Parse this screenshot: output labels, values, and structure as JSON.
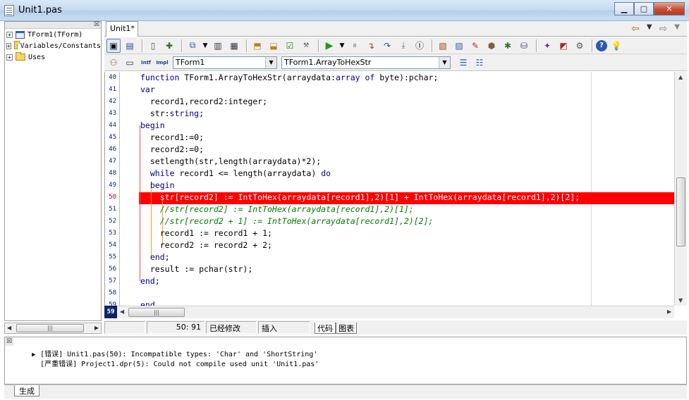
{
  "window": {
    "title": "Unit1.pas"
  },
  "tree": {
    "items": [
      {
        "label": "TForm1(TForm)",
        "icon": "form-icon"
      },
      {
        "label": "Variables/Constants",
        "icon": "folder-icon"
      },
      {
        "label": "Uses",
        "icon": "folder-icon"
      }
    ]
  },
  "editor": {
    "tab_label": "Unit1*",
    "class_combo": "TForm1",
    "method_combo": "TForm1.ArrayToHexStr",
    "error_line": 50,
    "lines": [
      {
        "n": "40",
        "segments": [
          {
            "t": "function ",
            "c": "kw"
          },
          {
            "t": "TForm1.ArrayToHexStr(arraydata:",
            "c": ""
          },
          {
            "t": "array of ",
            "c": "kw"
          },
          {
            "t": "byte):pchar;",
            "c": ""
          }
        ]
      },
      {
        "n": "41",
        "segments": [
          {
            "t": "var",
            "c": "kw"
          }
        ]
      },
      {
        "n": "42",
        "segments": [
          {
            "t": "  record1,record2:integer;",
            "c": ""
          }
        ]
      },
      {
        "n": "43",
        "segments": [
          {
            "t": "  str:",
            "c": ""
          },
          {
            "t": "string",
            "c": "kw"
          },
          {
            "t": ";",
            "c": ""
          }
        ]
      },
      {
        "n": "44",
        "segments": [
          {
            "t": "begin",
            "c": "kw"
          }
        ]
      },
      {
        "n": "45",
        "segments": [
          {
            "t": "  record1:=0;",
            "c": ""
          }
        ]
      },
      {
        "n": "46",
        "segments": [
          {
            "t": "  record2:=0;",
            "c": ""
          }
        ]
      },
      {
        "n": "47",
        "segments": [
          {
            "t": "  setlength(str,length(arraydata)*2);",
            "c": ""
          }
        ]
      },
      {
        "n": "48",
        "segments": [
          {
            "t": "  ",
            "c": ""
          },
          {
            "t": "while ",
            "c": "kw"
          },
          {
            "t": "record1 <= length(arraydata) ",
            "c": ""
          },
          {
            "t": "do",
            "c": "kw"
          }
        ]
      },
      {
        "n": "49",
        "segments": [
          {
            "t": "  ",
            "c": ""
          },
          {
            "t": "begin",
            "c": "kw"
          }
        ]
      },
      {
        "n": "50",
        "segments": [
          {
            "t": "    str[record2] := IntToHex(arraydata[record1],2)[1] + IntToHex(arraydata[record1],2)[2];",
            "c": "err"
          }
        ]
      },
      {
        "n": "51",
        "segments": [
          {
            "t": "    //str[record2] := IntToHex(arraydata[record1],2)[1];",
            "c": "cm"
          }
        ]
      },
      {
        "n": "52",
        "segments": [
          {
            "t": "    //str[record2 + 1] := IntToHex(arraydata[record1],2)[2];",
            "c": "cm"
          }
        ]
      },
      {
        "n": "53",
        "segments": [
          {
            "t": "    record1 := record1 + 1;",
            "c": ""
          }
        ]
      },
      {
        "n": "54",
        "segments": [
          {
            "t": "    record2 := record2 + 2;",
            "c": ""
          }
        ]
      },
      {
        "n": "55",
        "segments": [
          {
            "t": "  ",
            "c": ""
          },
          {
            "t": "end",
            "c": "kw"
          },
          {
            "t": ";",
            "c": ""
          }
        ]
      },
      {
        "n": "56",
        "segments": [
          {
            "t": "  result := pchar(str);",
            "c": ""
          }
        ]
      },
      {
        "n": "57",
        "segments": [
          {
            "t": "end",
            "c": "kw"
          },
          {
            "t": ";",
            "c": ""
          }
        ]
      },
      {
        "n": "58",
        "segments": []
      },
      {
        "n": "59",
        "segments": [
          {
            "t": "end",
            "c": "kw"
          }
        ]
      }
    ],
    "current_line": "59"
  },
  "status": {
    "position": "50: 91",
    "modified": "已经修改",
    "mode": "插入",
    "tab_code": "代码",
    "tab_diagram": "图表"
  },
  "messages": {
    "items": [
      {
        "marker": "▶",
        "text": "[错误] Unit1.pas(50): Incompatible types: 'Char' and 'ShortString'"
      },
      {
        "marker": "",
        "text": "[严重错误] Project1.dpr(5): Could not compile used unit 'Unit1.pas'"
      }
    ],
    "tab_label": "生成"
  },
  "colors": {
    "error_line": "#ff0000",
    "keyword": "#000080",
    "comment": "#008000"
  }
}
